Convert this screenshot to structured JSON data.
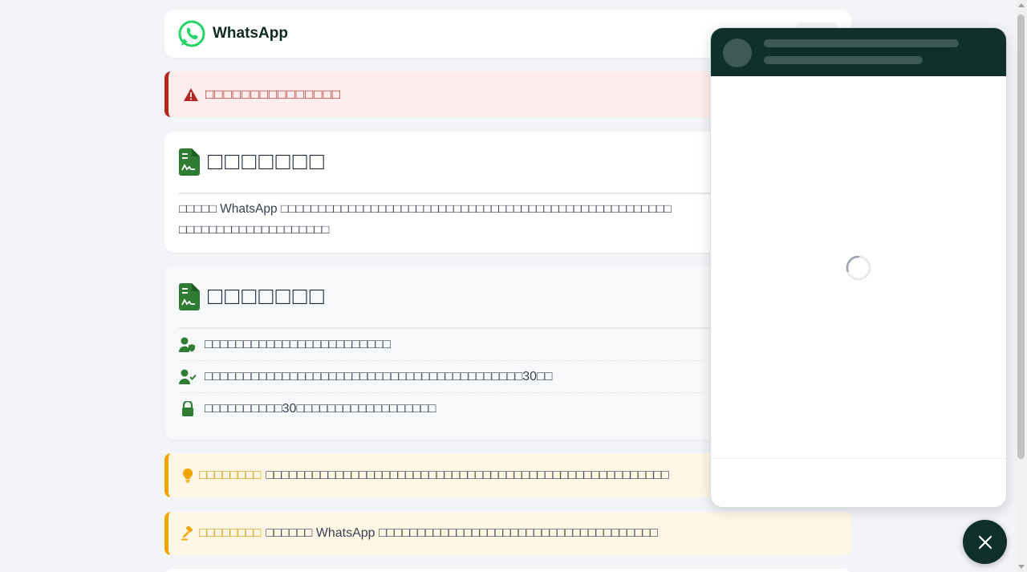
{
  "header": {
    "brand": "WhatsApp"
  },
  "alert": {
    "text": "□□□□□□□□□□□□□□□",
    "icon": "warning-triangle-icon",
    "color": "#b3261e"
  },
  "card1": {
    "title": "□□□□□□□",
    "body_1": "□□□□□ WhatsApp □□□□□□□□□□□□□□□□□□□□□□□□□□□□□□□□□□□□□□□□□□□□□□□□□□□□",
    "body_2": "□□□□□□□□□□□□□□□□□□□□"
  },
  "card2": {
    "title": "□□□□□□□",
    "items": [
      {
        "icon": "user-shield-icon",
        "text": "□□□□□□□□□□□□□□□□□□□□□□□□"
      },
      {
        "icon": "user-check-icon",
        "text": "□□□□□□□□□□□□□□□□□□□□□□□□□□□□□□□□□□□□□□□□□30□□"
      },
      {
        "icon": "lock-icon",
        "text": "□□□□□□□□□□30□□□□□□□□□□□□□□□□□□"
      }
    ]
  },
  "tip1": {
    "label": "□□□□□□□□",
    "text": "□□□□□□□□□□□□□□□□□□□□□□□□□□□□□□□□□□□□□□□□□□□□□□□□□□□□"
  },
  "tip2": {
    "label": "□□□□□□□□",
    "text": "□□□□□□ WhatsApp □□□□□□□□□□□□□□□□□□□□□□□□□□□□□□□□□□□□"
  },
  "colors": {
    "brand_green": "#25d366",
    "dark_green": "#0f2f28",
    "doc_green": "#2e7d32",
    "tip_orange": "#f0a500"
  }
}
